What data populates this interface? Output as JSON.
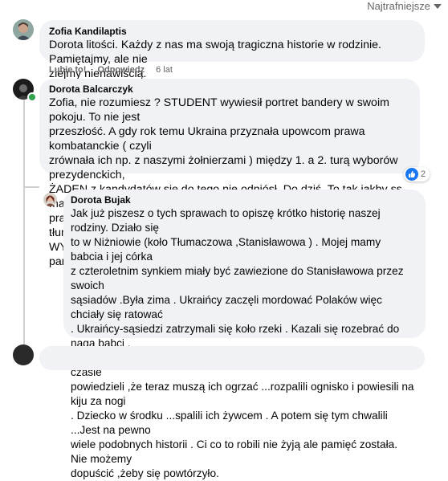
{
  "sort": {
    "label": "Najtrafniejsze"
  },
  "comments": [
    {
      "author": "Zofia Kandilaptis",
      "text": "Dorota litości. Każdy z nas ma swoją tragiczna historie w rodzinie. Pamiętajmy, ale nie\nziejmy nienawiścią.",
      "like": "Lubię to!",
      "reply": "Odpowiedz",
      "time": "6 lat"
    },
    {
      "author": "Dorota Balcarczyk",
      "text": "Zofia, nie rozumiesz ? STUDENT wywiesił portret bandery w swoim pokoju. To nie jest\nprzeszłość. A gdy rok temu Ukraina przyznała upowcom prawa kombatanckie ( czyli\nzrównała ich np. z naszymi żołnierzami ) między 1. a 2. turą wyborów prezydenckich,\nŻADEN z kandydatów się do tego nie odniósł. Do dziś. To tak jakby ss-manom przyznać\nprawa kombatanckie. Nie na darmo car KOZAKÓW używał do tłumienia zamieszek.\nWYBACZYĆ TO WIELKOŚĆ, ZAPOMNIEĆ GŁUPOTA. Trzeba pamiętać, by zapobiegać.",
      "reactions": {
        "count": "2",
        "icon": "like-icon",
        "color": "#1877f2"
      }
    },
    {
      "author": "Dorota Bujak",
      "text": "Jak już piszesz o tych sprawach to opiszę krótko historię naszej rodziny. Działo się\nto w Niżniowie (koło Tłumaczowa ,Stanisławowa ) . Mojej mamy babcia i jej córka\nz czteroletnim synkiem miały być zawiezione do Stanisławowa przez swoich\nsąsiadów .Była zima . Ukraińcy zaczęli mordować Polaków więc chciały się ratować\n. Ukraińcy-sąsiedzi zatrzymali się koło rzeki . Kazali się rozebrać do naga babci ,\ncórce i jej dziecku . Potem wsadzili ich do lodowatej wody. Po jakimś czasie\npowiedzieli ,że teraz muszą ich ogrzać ...rozpalili ognisko i powiesili na kiju za nogi\n. Dziecko w środku ...spalili ich żywcem . A potem się tym chwalili ...Jest na pewno\nwiele podobnych historii . Ci co to robili nie żyją ale pamięć została. Nie możemy\ndopuścić ,żeby się powtórzyło."
    }
  ],
  "colors": {
    "bubble": "#f0f2f5",
    "meta": "#65676b",
    "online": "#31a24c"
  }
}
